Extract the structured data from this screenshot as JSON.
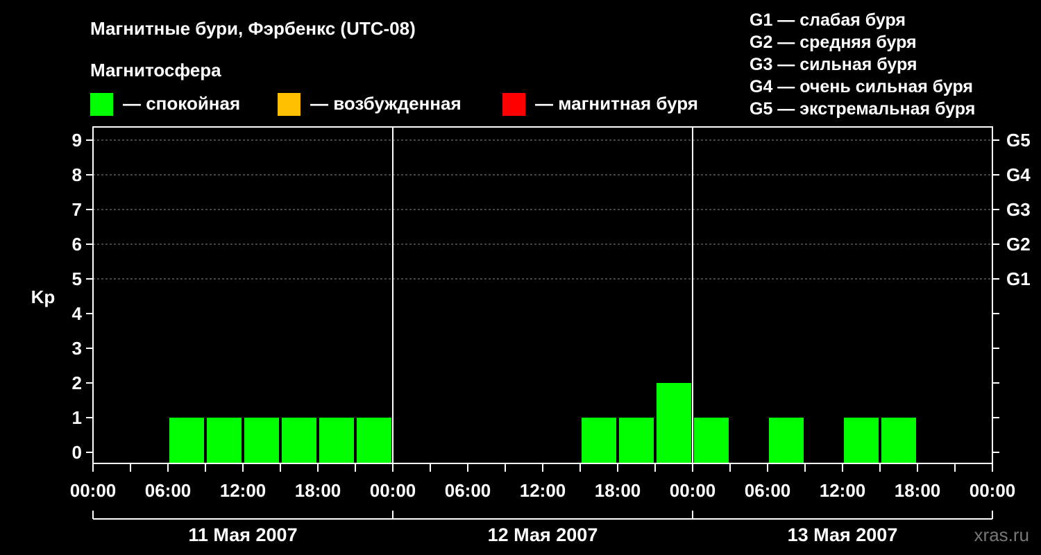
{
  "chart_data": {
    "type": "bar",
    "title": "Магнитные бури, Фэрбенкс (UTC-08)",
    "ylabel": "Kp",
    "ylim": [
      0,
      9
    ],
    "yticks": [
      "0",
      "1",
      "2",
      "3",
      "4",
      "5",
      "6",
      "7",
      "8",
      "9"
    ],
    "storm_levels": [
      {
        "label": "G1",
        "kp": 5
      },
      {
        "label": "G2",
        "kp": 6
      },
      {
        "label": "G3",
        "kp": 7
      },
      {
        "label": "G4",
        "kp": 8
      },
      {
        "label": "G5",
        "kp": 9
      }
    ],
    "storm_legend": [
      "G1 — слабая буря",
      "G2 — средняя буря",
      "G3 — сильная буря",
      "G4 — очень сильная буря",
      "G5 — экстремальная буря"
    ],
    "legend_title": "Магнитосфера",
    "legend": [
      {
        "label": "— спокойная",
        "color": "#00ff00"
      },
      {
        "label": "— возбужденная",
        "color": "#ffc000"
      },
      {
        "label": "— магнитная буря",
        "color": "#ff0000"
      }
    ],
    "x_tick_labels": [
      "00:00",
      "06:00",
      "12:00",
      "18:00",
      "00:00",
      "06:00",
      "12:00",
      "18:00",
      "00:00",
      "06:00",
      "12:00",
      "18:00",
      "00:00"
    ],
    "days": [
      "11 Мая 2007",
      "12 Мая 2007",
      "13 Мая 2007"
    ],
    "bar_hours": 3,
    "x_units": "hours from 00:00, 11 May 2007",
    "x": [
      3,
      6,
      9,
      12,
      15,
      18,
      21,
      24,
      27,
      30,
      33,
      36,
      39,
      42,
      45,
      48,
      51,
      54,
      57,
      60,
      63,
      66,
      69
    ],
    "values": [
      0,
      1,
      1,
      1,
      1,
      1,
      1,
      0,
      0,
      0,
      0,
      0,
      1,
      1,
      2,
      1,
      0,
      1,
      0,
      1,
      1,
      0,
      0
    ],
    "bar_color": "#00ff00",
    "grid": "horizontal dashed at Kp 5–9"
  },
  "watermark": "xras.ru"
}
